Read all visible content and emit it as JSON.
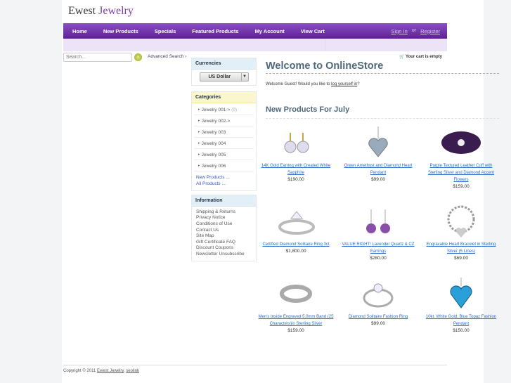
{
  "logo": {
    "part1": "Ewest",
    "part2": "Jewelry"
  },
  "nav": {
    "items": [
      "Home",
      "New Products",
      "Specials",
      "Featured Products",
      "My Account",
      "View Cart"
    ],
    "sign_in": "Sign In",
    "or": "or",
    "register": "Register"
  },
  "search": {
    "placeholder": "Search...",
    "advanced": "Advanced Search ›"
  },
  "cart": {
    "text": "Your cart is empty"
  },
  "currencies": {
    "title": "Currencies",
    "selected": "US Dollar"
  },
  "categories": {
    "title": "Categories",
    "items": [
      {
        "label": "Jewelry 001->",
        "count": "(9)"
      },
      {
        "label": "Jewelry 002->"
      },
      {
        "label": "Jewelry 003"
      },
      {
        "label": "Jewelry 004"
      },
      {
        "label": "Jewelry 005"
      },
      {
        "label": "Jewelry 006"
      }
    ],
    "new_products": "New Products ...",
    "all_products": "All Products ..."
  },
  "information": {
    "title": "Information",
    "items": [
      "Shipping & Returns",
      "Privacy Notice",
      "Conditions of Use",
      "Contact Us",
      "Site Map",
      "Gift Certificate FAQ",
      "Discount Coupons",
      "Newsletter Unsubscribe"
    ]
  },
  "main": {
    "title": "Welcome to OnlineStore",
    "welcome_prefix": "Welcome Guest! Would you like to ",
    "login_link": "log yourself in",
    "welcome_suffix": "?",
    "new_title": "New Products For July"
  },
  "products": [
    {
      "name": "14K Gold Earring with Created White Sapphire",
      "price": "$190.00"
    },
    {
      "name": "Green Amethyst and Diamond Heart Pendant",
      "price": "$99.00"
    },
    {
      "name": "Purple Textured Leather Cuff with Sterling Silver and Diamond Accent Flowers",
      "price": "$159.00"
    },
    {
      "name": "Certified Diamond Solitaire Ring 3ct",
      "price": "$1,800.00"
    },
    {
      "name": "VALUE RIGHT! Lavender Quartz & CZ Earrings",
      "price": "$280.00"
    },
    {
      "name": "Engravable Heart Bracelet in Sterling Silver (5 Lines)",
      "price": "$69.00"
    },
    {
      "name": "Men's Inside Engraved 5.0mm Band (25 Characters)in Sterling Silver",
      "price": "$159.00"
    },
    {
      "name": "Diamond Solitaire Fashion Ring",
      "price": "$99.00"
    },
    {
      "name": "10kt. White Gold, Blue Topaz Fashion Pendant",
      "price": "$150.00"
    }
  ],
  "footer": {
    "copyright": "Copyright © 2011",
    "link1": "Ewest Jewelry",
    "sep": ",",
    "link2": "seolink"
  }
}
